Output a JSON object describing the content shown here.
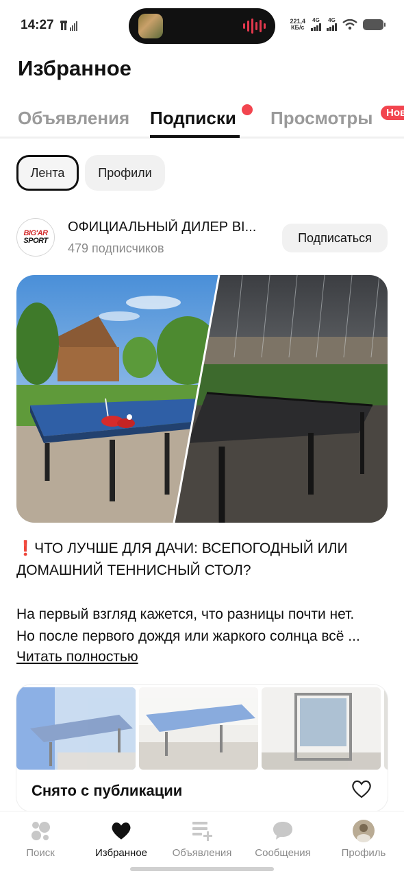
{
  "status_bar": {
    "time": "14:27",
    "net_speed_value": "221,4",
    "net_speed_unit": "КБ/с",
    "signal_1_label": "4G",
    "signal_2_label": "4G"
  },
  "header": {
    "title": "Избранное"
  },
  "tabs": [
    {
      "label": "Объявления",
      "active": false
    },
    {
      "label": "Подписки",
      "active": true
    },
    {
      "label": "Просмотры",
      "active": false
    }
  ],
  "new_badge": "Нов",
  "filter_chips": [
    {
      "label": "Лента",
      "active": true
    },
    {
      "label": "Профили",
      "active": false
    }
  ],
  "seller": {
    "logo_top": "BIG'AR",
    "logo_bottom": "SPORT",
    "name": "ОФИЦИАЛЬНЫЙ ДИЛЕР BI...",
    "subscribers": "479 подписчиков",
    "subscribe_label": "Подписаться"
  },
  "post": {
    "title_icon": "❗",
    "title": "ЧТО ЛУЧШЕ ДЛЯ ДАЧИ: ВСЕПОГОДНЫЙ ИЛИ ДОМАШНИЙ ТЕННИСНЫЙ СТОЛ?",
    "body_line_1": "На первый взгляд кажется, что разницы почти нет.",
    "body_line_2": "Но после первого дождя или жаркого солнца всё ...",
    "read_more": "Читать полностью"
  },
  "listing": {
    "status": "Снято с публикации"
  },
  "bottom_nav": [
    {
      "label": "Поиск",
      "icon": "search-dots-icon",
      "active": false
    },
    {
      "label": "Избранное",
      "icon": "heart-icon",
      "active": true
    },
    {
      "label": "Объявления",
      "icon": "listings-add-icon",
      "active": false
    },
    {
      "label": "Сообщения",
      "icon": "chat-bubble-icon",
      "active": false
    },
    {
      "label": "Профиль",
      "icon": "profile-avatar-icon",
      "active": false
    }
  ],
  "colors": {
    "accent_red": "#f2454f",
    "text_primary": "#111111",
    "text_muted": "#8a8a8a",
    "chip_bg": "#f1f1f1"
  }
}
